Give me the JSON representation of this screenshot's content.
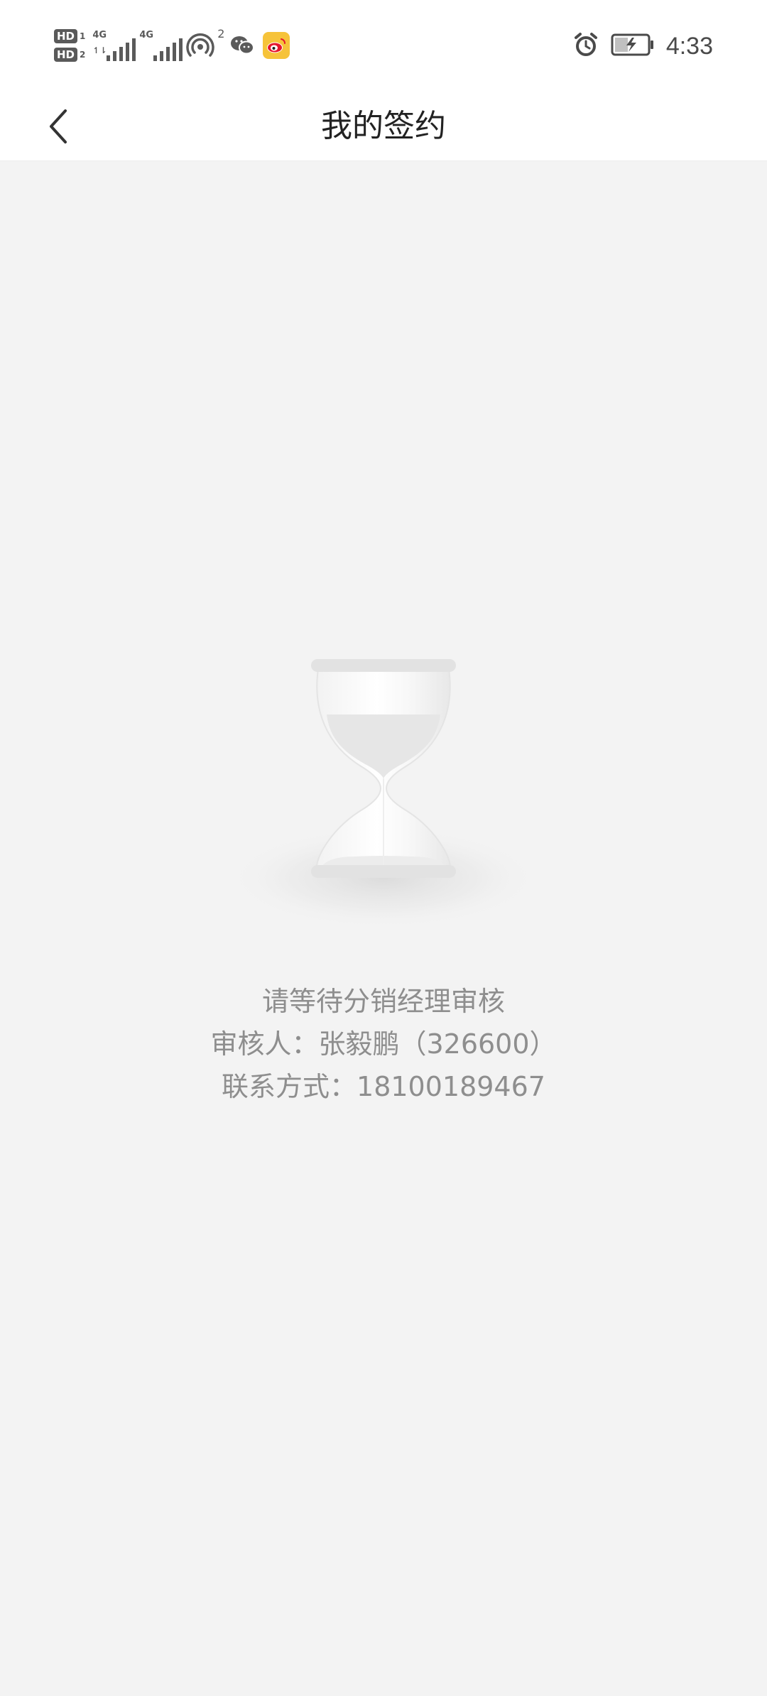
{
  "status_bar": {
    "sim1_label": "HD",
    "sim1_index": "1",
    "sim2_label": "HD",
    "sim2_index": "2",
    "net1_label": "4G",
    "net2_label": "4G",
    "hotspot_count": "2",
    "time": "4:33",
    "icons": [
      "hd-sim-icon",
      "signal-icon",
      "hotspot-icon",
      "wechat-icon",
      "weibo-icon",
      "alarm-icon",
      "battery-charging-icon"
    ],
    "weibo_color": "#f6c33a"
  },
  "header": {
    "title": "我的签约",
    "back_icon": "chevron-left-icon"
  },
  "main": {
    "illustration": "hourglass-icon",
    "lines": [
      "请等待分销经理审核",
      "审核人：张毅鹏（326600）",
      "联系方式：18100189467"
    ]
  },
  "colors": {
    "background": "#f3f3f3",
    "header_bg": "#ffffff",
    "title_text": "#222222",
    "message_text": "#8e8e8e"
  }
}
